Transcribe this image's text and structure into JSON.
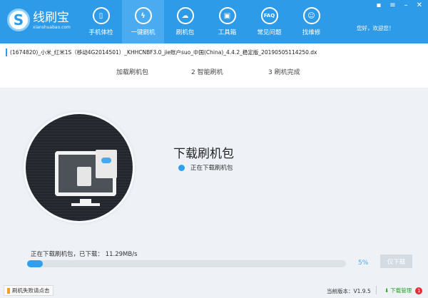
{
  "app": {
    "name": "线刷宝",
    "url": "xianshuabao.com",
    "greeting": "您好，欢迎您！"
  },
  "nav": [
    {
      "label": "手机体检",
      "icon": "phone-check-icon"
    },
    {
      "label": "一键刷机",
      "icon": "lightning-icon",
      "active": true
    },
    {
      "label": "刷机包",
      "icon": "cloud-download-icon"
    },
    {
      "label": "工具箱",
      "icon": "toolbox-icon"
    },
    {
      "label": "常见问题",
      "icon": "faq-icon",
      "glyph": "FAQ"
    },
    {
      "label": "找维修",
      "icon": "repair-person-icon"
    }
  ],
  "file": {
    "name": "(1674820)_小米_红米1S（移动4G2014501）_KHHCNBF3.0_jie账户suo_中国(China)_4.4.2_稳定版_20190505114250.dx"
  },
  "steps": [
    "加载刷机包",
    "2  智能刷机",
    "3  刷机完成"
  ],
  "main": {
    "title": "下载刷机包",
    "status": "正在下载刷机包"
  },
  "download": {
    "info": "正在下载刷机包，已下载： 11.29MB/s",
    "percent": 5,
    "percent_label": "5%",
    "button": "仅下载"
  },
  "footer": {
    "fail_link": "刷机失败请点击",
    "version": "当前版本：V1.9.5",
    "download_manager": "下载管理",
    "badge": "1"
  },
  "colors": {
    "accent": "#2e9be9",
    "progress": "#2f9ff0",
    "download_manager": "#2aa12a"
  }
}
